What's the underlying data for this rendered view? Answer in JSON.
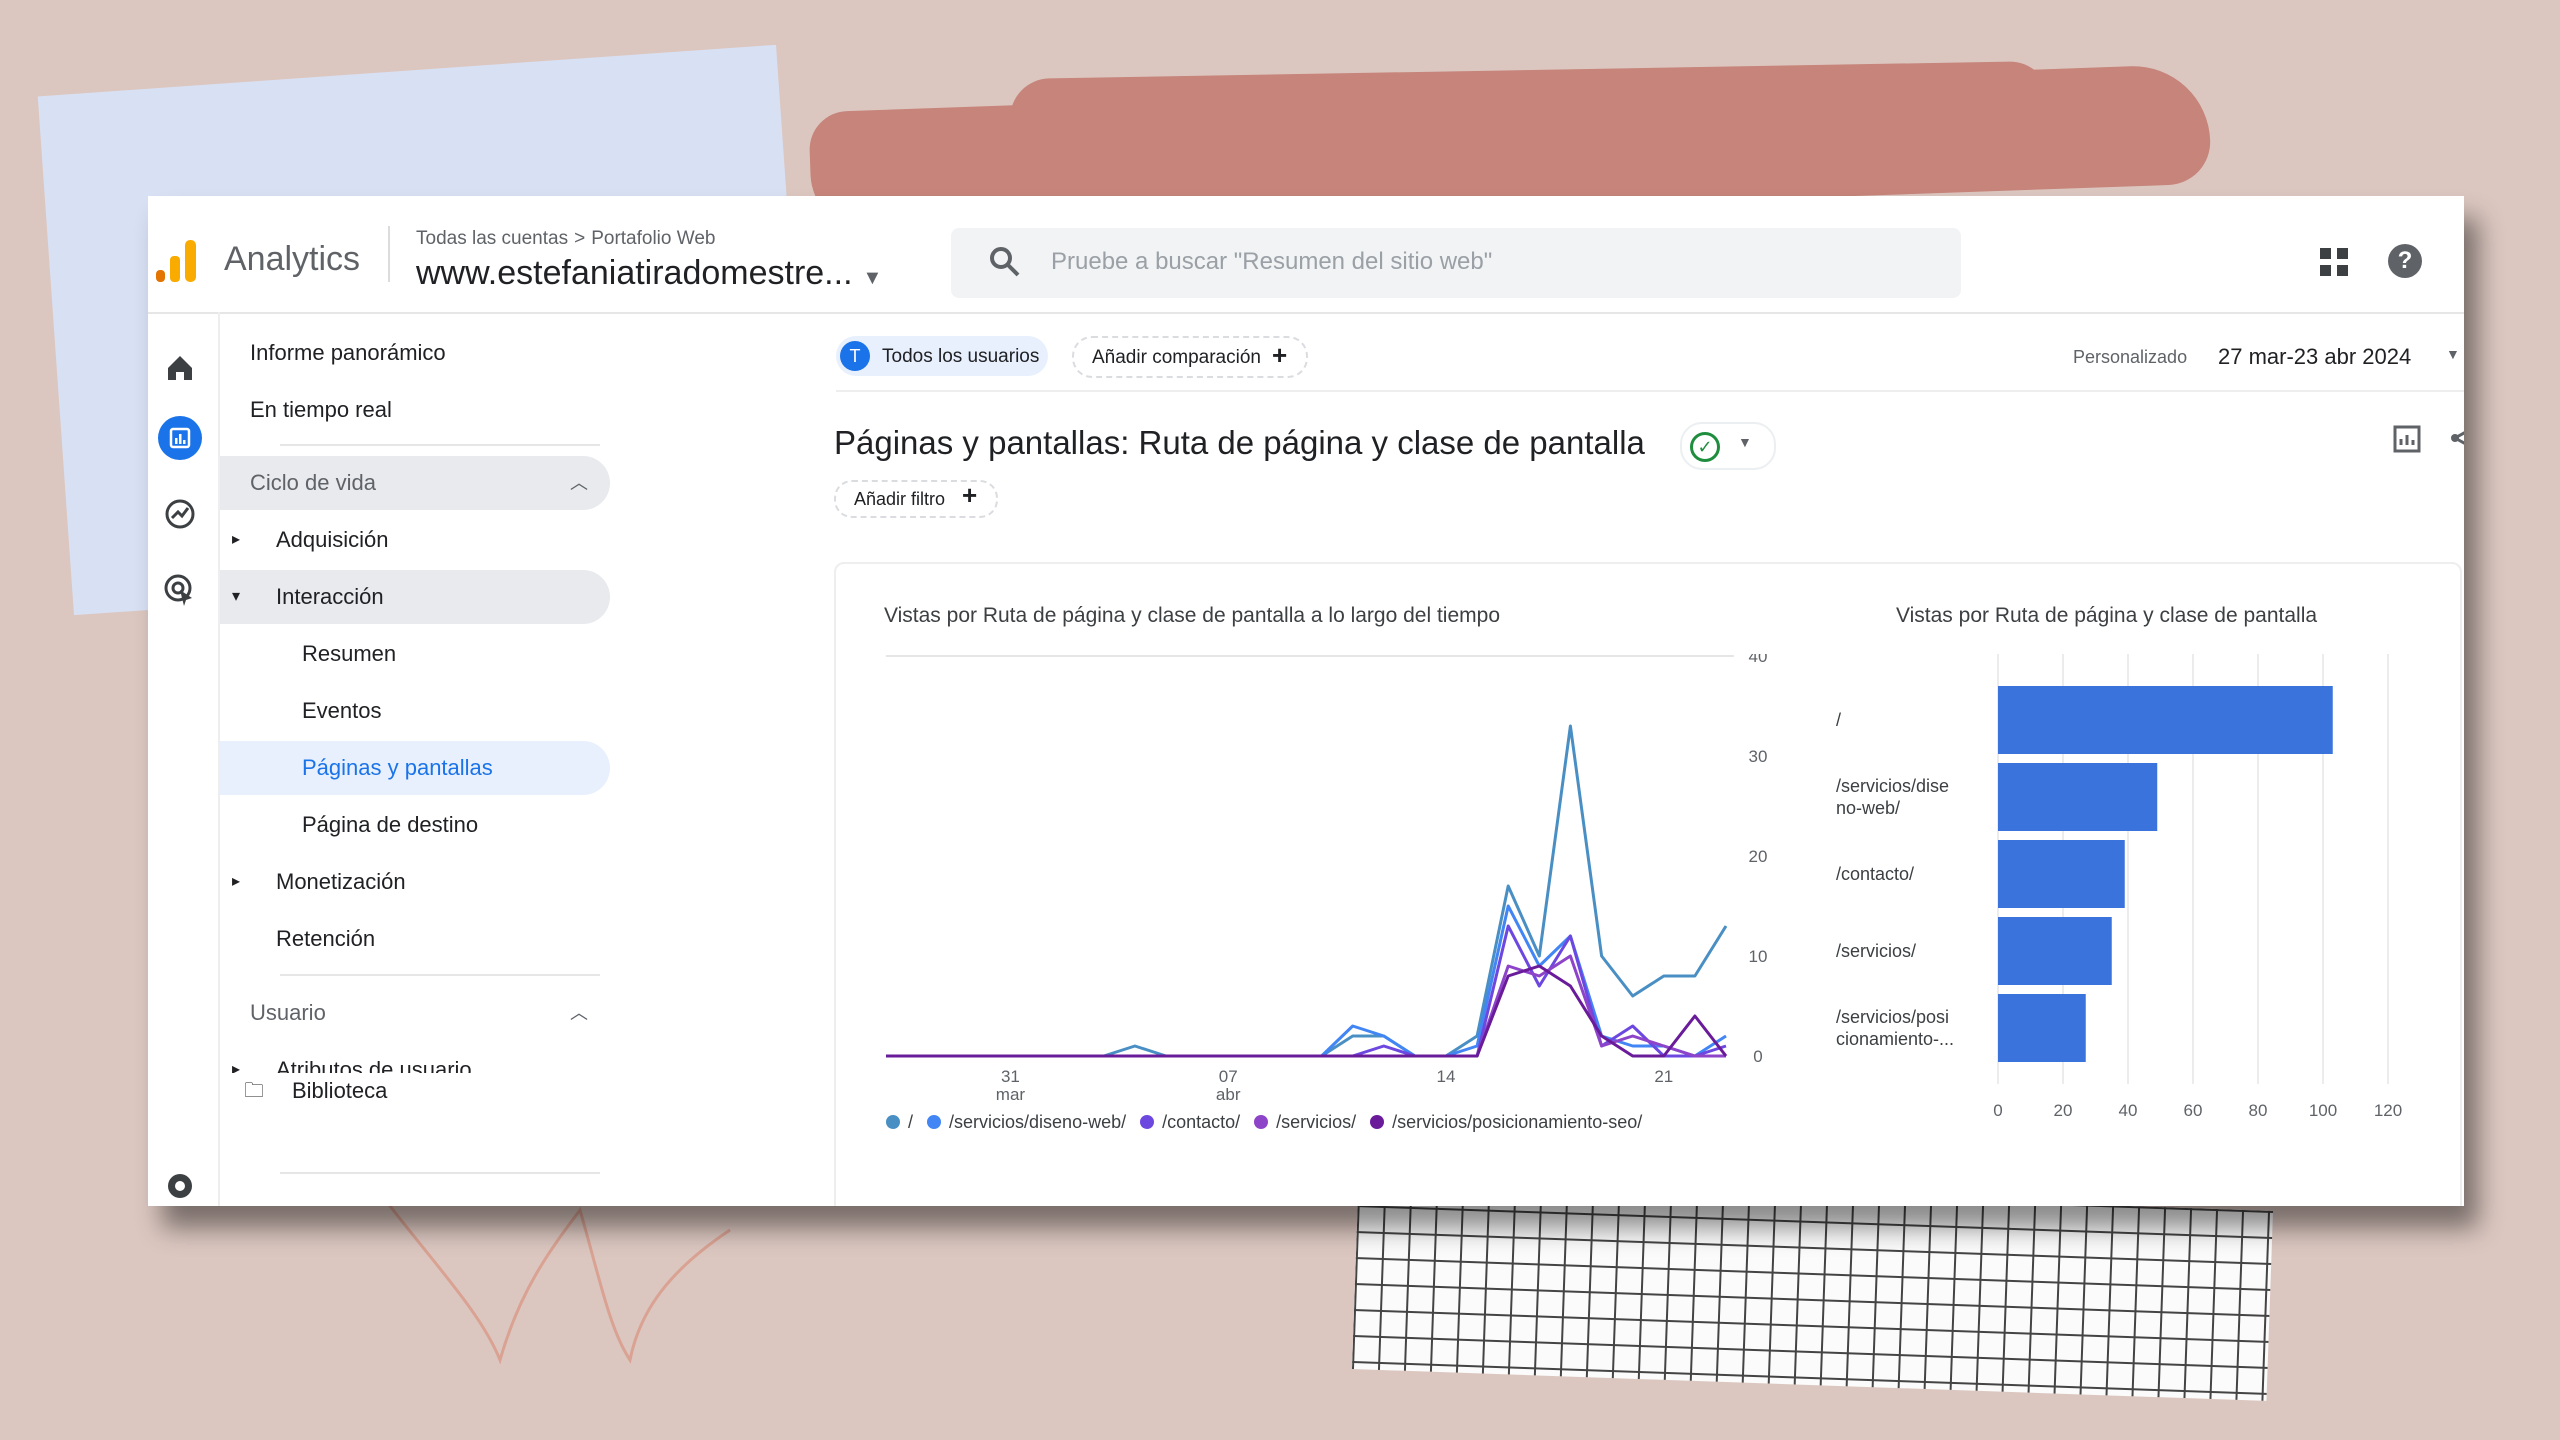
{
  "header": {
    "app_name": "Analytics",
    "breadcrumb": [
      "Todas las cuentas",
      "Portafolio Web"
    ],
    "breadcrumb_sep": ">",
    "property": "www.estefaniatiradomestre...",
    "search_placeholder": "Pruebe a buscar \"Resumen del sitio web\"",
    "icons": [
      "analytics-logo-icon",
      "search-icon",
      "apps-grid-icon",
      "help-icon"
    ]
  },
  "rail": {
    "icons": [
      "home-icon",
      "reports-icon",
      "explore-icon",
      "advertising-icon",
      "settings-icon"
    ]
  },
  "nav": {
    "overview": "Informe panorámico",
    "realtime": "En tiempo real",
    "lifecycle": "Ciclo de vida",
    "acquisition": "Adquisición",
    "engagement": "Interacción",
    "summary": "Resumen",
    "events": "Eventos",
    "pages": "Páginas y pantallas",
    "landing": "Página de destino",
    "monetization": "Monetización",
    "retention": "Retención",
    "user": "Usuario",
    "user_attributes": "Atributos de usuario",
    "library": "Biblioteca"
  },
  "toolbar": {
    "segment_initial": "T",
    "segment": "Todos los usuarios",
    "add_comparison": "Añadir comparación",
    "custom_label": "Personalizado",
    "date_range": "27 mar-23 abr 2024",
    "title": "Páginas y pantallas: Ruta de página y clase de pantalla",
    "add_filter": "Añadir filtro"
  },
  "colors": {
    "accent": "#1a73e8",
    "success": "#1e8e3e"
  },
  "chart_data": [
    {
      "type": "line",
      "title": "Vistas por Ruta de página y clase de pantalla a lo largo del tiempo",
      "x_ticks": [
        {
          "label": "31",
          "sub": "mar",
          "day": 4
        },
        {
          "label": "07",
          "sub": "abr",
          "day": 11
        },
        {
          "label": "14",
          "sub": "",
          "day": 18
        },
        {
          "label": "21",
          "sub": "",
          "day": 25
        }
      ],
      "ylim": [
        0,
        40
      ],
      "y_ticks": [
        0,
        10,
        20,
        30,
        40
      ],
      "series": [
        {
          "name": "/",
          "color": "#4a8fc4",
          "values": [
            0,
            0,
            0,
            0,
            0,
            0,
            0,
            0,
            1,
            0,
            0,
            0,
            0,
            0,
            0,
            2,
            2,
            0,
            0,
            2,
            17,
            10,
            33,
            10,
            6,
            8,
            8,
            13
          ]
        },
        {
          "name": "/servicios/diseno-web/",
          "color": "#4285f4",
          "values": [
            0,
            0,
            0,
            0,
            0,
            0,
            0,
            0,
            0,
            0,
            0,
            0,
            0,
            0,
            0,
            3,
            2,
            0,
            0,
            1,
            15,
            9,
            12,
            2,
            1,
            1,
            0,
            2
          ]
        },
        {
          "name": "/contacto/",
          "color": "#6d48e0",
          "values": [
            0,
            0,
            0,
            0,
            0,
            0,
            0,
            0,
            0,
            0,
            0,
            0,
            0,
            0,
            0,
            0,
            1,
            0,
            0,
            0,
            13,
            7,
            12,
            1,
            3,
            0,
            0,
            1
          ]
        },
        {
          "name": "/servicios/",
          "color": "#8e44c9",
          "values": [
            0,
            0,
            0,
            0,
            0,
            0,
            0,
            0,
            0,
            0,
            0,
            0,
            0,
            0,
            0,
            0,
            0,
            0,
            0,
            0,
            9,
            8,
            10,
            1,
            2,
            1,
            0,
            0
          ]
        },
        {
          "name": "/servicios/posicionamiento-seo/",
          "color": "#6a1b9a",
          "values": [
            0,
            0,
            0,
            0,
            0,
            0,
            0,
            0,
            0,
            0,
            0,
            0,
            0,
            0,
            0,
            0,
            0,
            0,
            0,
            0,
            8,
            9,
            7,
            2,
            0,
            0,
            4,
            0
          ]
        }
      ]
    },
    {
      "type": "bar",
      "orientation": "horizontal",
      "title": "Vistas por Ruta de página y clase de pantalla",
      "categories": [
        [
          "/"
        ],
        [
          "/servicios/dise",
          "no-web/"
        ],
        [
          "/contacto/"
        ],
        [
          "/servicios/"
        ],
        [
          "/servicios/posi",
          "cionamiento-..."
        ]
      ],
      "values": [
        103,
        49,
        39,
        35,
        27
      ],
      "xlim": [
        0,
        120
      ],
      "x_ticks": [
        0,
        20,
        40,
        60,
        80,
        100,
        120
      ],
      "color": "#3a73db"
    }
  ]
}
